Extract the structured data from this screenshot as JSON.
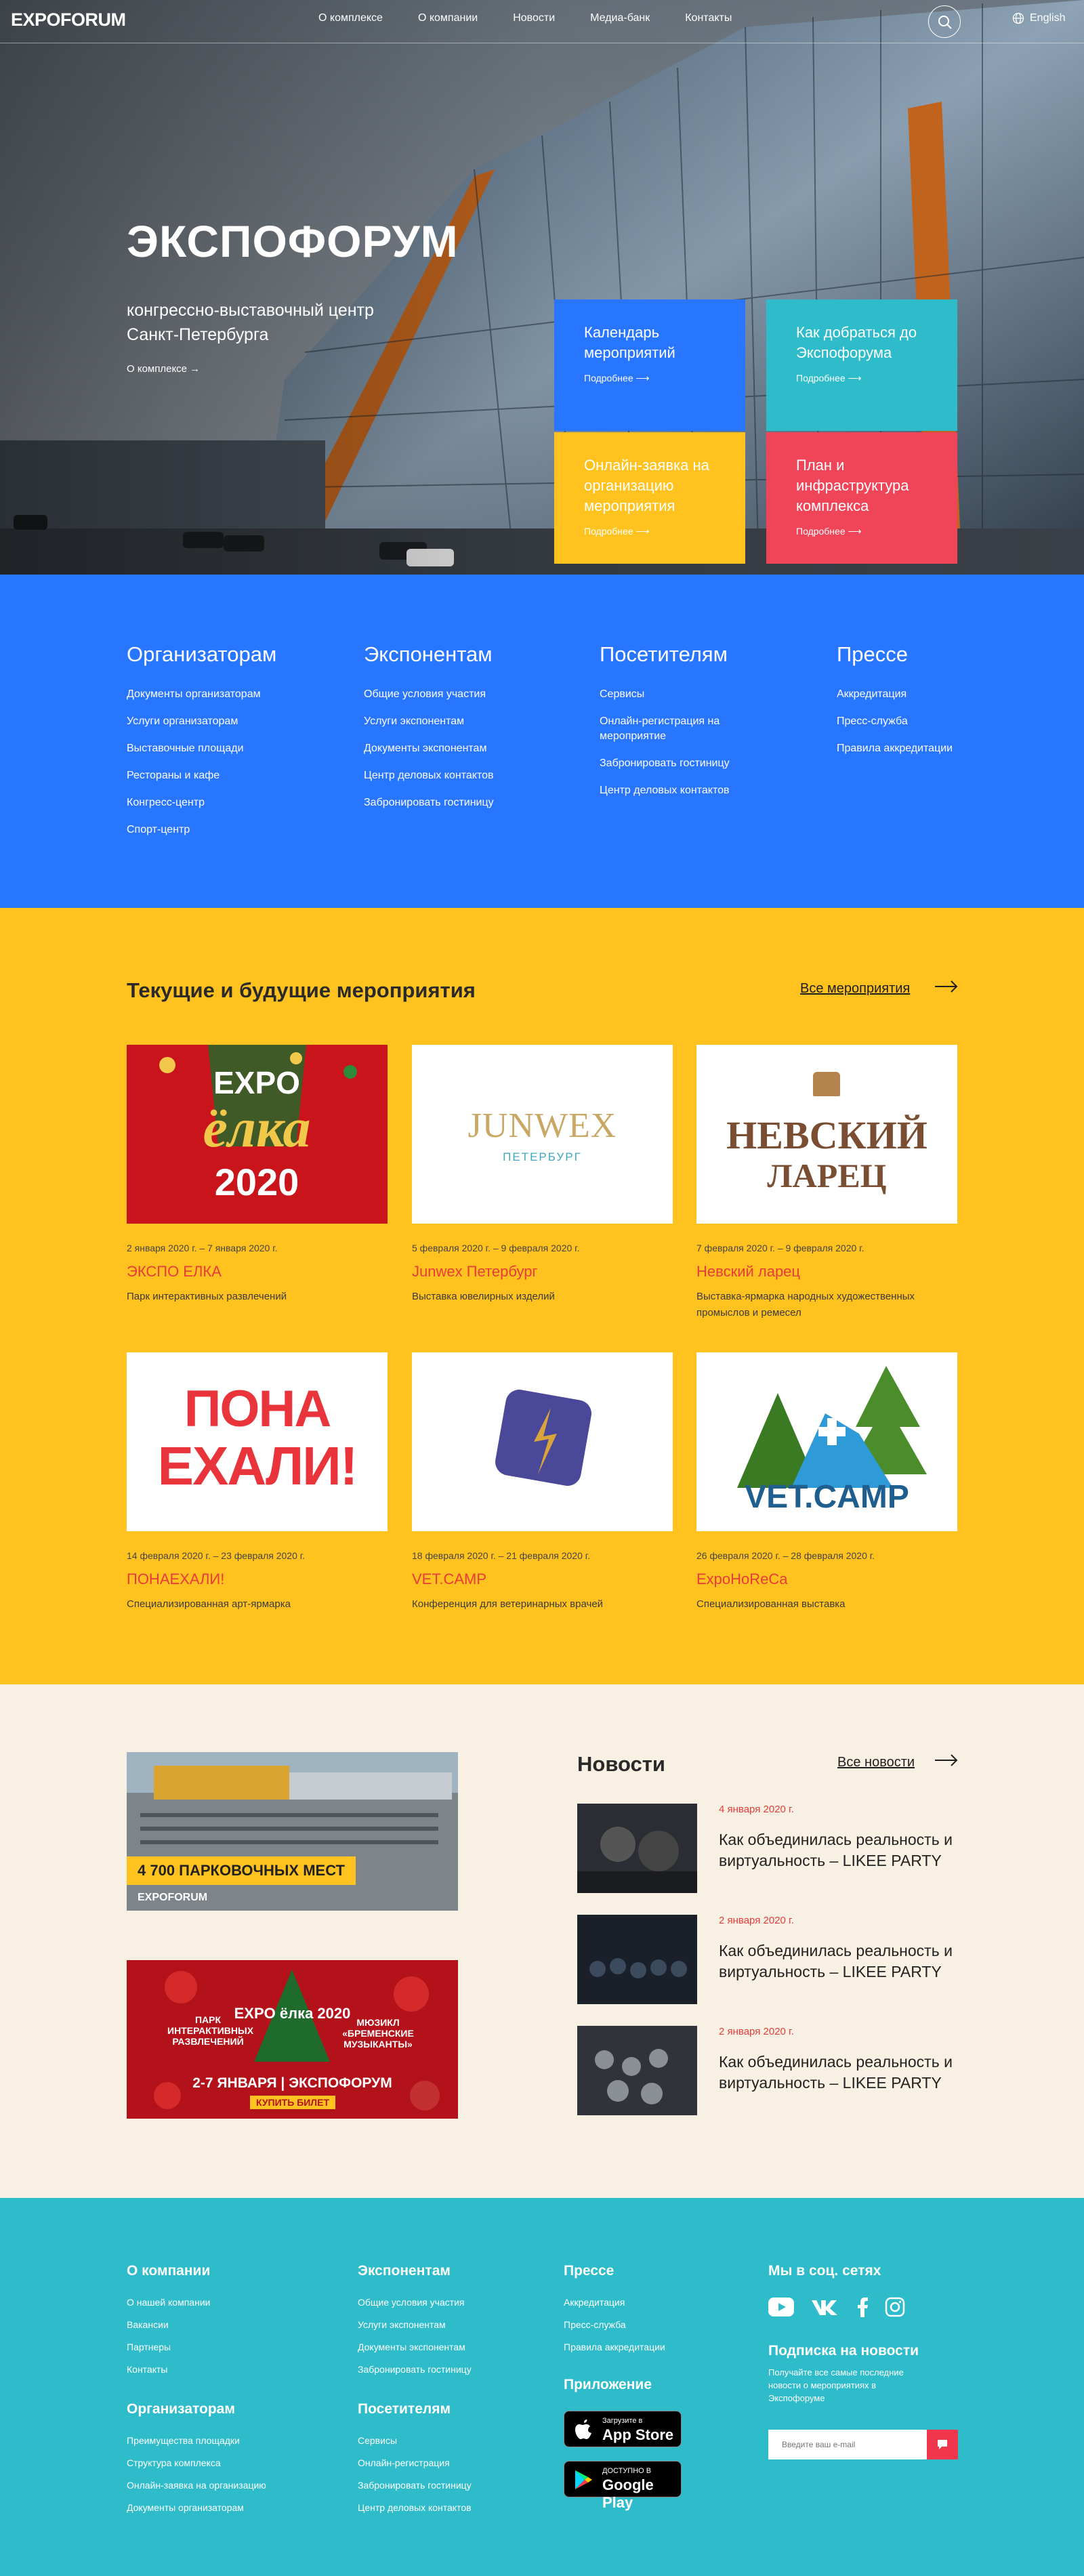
{
  "header": {
    "logo": "EXPOFORUM",
    "nav": [
      "О комплексе",
      "О компании",
      "Новости",
      "Медиа-банк",
      "Контакты"
    ],
    "lang": "English"
  },
  "hero": {
    "title": "ЭКСПОФОРУМ",
    "subtitle": "конгрессно-выставочный центр Санкт-Петербурга",
    "link": "О комплексе →",
    "tiles": [
      {
        "title": "Календарь мероприятий",
        "more": "Подробнее ⟶",
        "color": "#2876ff"
      },
      {
        "title": "Как добраться до Экспофорума",
        "more": "Подробнее ⟶",
        "color": "#2ebccb"
      },
      {
        "title": "Онлайн-заявка на организацию мероприятия",
        "more": "Подробнее ⟶",
        "color": "#ffc21e"
      },
      {
        "title": "План и инфраструктура комплекса",
        "more": "Подробнее ⟶",
        "color": "#f04458"
      }
    ]
  },
  "audience": [
    {
      "title": "Организаторам",
      "links": [
        "Документы организаторам",
        "Услуги организаторам",
        "Выставочные площади",
        "Рестораны и кафе",
        "Конгресс-центр",
        "Спорт-центр"
      ]
    },
    {
      "title": "Экспонентам",
      "links": [
        "Общие условия участия",
        "Услуги экспонентам",
        "Документы экспонентам",
        "Центр деловых контактов",
        "Забронировать гостиницу"
      ]
    },
    {
      "title": "Посетителям",
      "links": [
        "Сервисы",
        "Онлайн-регистрация на мероприятие",
        "Забронировать гостиницу",
        "Центр деловых контактов"
      ]
    },
    {
      "title": "Прессе",
      "links": [
        "Аккредитация",
        "Пресс-служба",
        "Правила аккредитации"
      ]
    }
  ],
  "events": {
    "title": "Текущие и будущие мероприятия",
    "all": "Все мероприятия",
    "items": [
      {
        "date": "2 января 2020 г. – 7 января 2020 г.",
        "name": "ЭКСПО ЕЛКА",
        "desc": "Парк интерактивных развлечений",
        "logo": "EXPO ёлка 2020"
      },
      {
        "date": "5 февраля 2020 г. – 9 февраля 2020 г.",
        "name": "Junwex Петербург",
        "desc": "Выставка ювелирных изделий",
        "logo": "JUNWEX",
        "logo2": "ПЕТЕРБУРГ"
      },
      {
        "date": "7 февраля 2020 г. – 9 февраля 2020 г.",
        "name": "Невский ларец",
        "desc": "Выставка-ярмарка народных художественных промыслов и ремесел",
        "logo": "НЕВСКИЙ",
        "logo2": "ЛАРЕЦ"
      },
      {
        "date": "14 февраля 2020 г. – 23 февраля 2020 г.",
        "name": "ПОНАЕХАЛИ!",
        "desc": "Специализированная арт-ярмарка",
        "logo": "ПОНА",
        "logo2": "ЕХАЛИ!"
      },
      {
        "date": "18 февраля 2020 г. – 21 февраля 2020 г.",
        "name": "VET.CAMP",
        "desc": "Конференция для ветеринарных врачей",
        "logo": ""
      },
      {
        "date": "26 февраля 2020 г. – 28 февраля 2020 г.",
        "name": "ExpoHoReCa",
        "desc": "Специализированная выставка",
        "logo": "VET.CAMP"
      }
    ]
  },
  "banners": {
    "parking": "4 700 ПАРКОВОЧНЫХ МЕСТ",
    "parking_logo": "EXPOFORUM",
    "elka_left": "ПАРК ИНТЕРАКТИВНЫХ РАЗВЛЕЧЕНИЙ",
    "elka_right": "МЮЗИКЛ «БРЕМЕНСКИЕ МУЗЫКАНТЫ»",
    "elka_logo": "EXPO ёлка 2020",
    "elka_dates": "2-7 ЯНВАРЯ | ЭКСПОФОРУМ",
    "elka_btn": "КУПИТЬ БИЛЕТ"
  },
  "news": {
    "title": "Новости",
    "all": "Все новости",
    "items": [
      {
        "date": "4 января 2020 г.",
        "title": "Как объединилась реальность и виртуальность – LIKEE PARTY"
      },
      {
        "date": "2 января 2020 г.",
        "title": "Как объединилась реальность и виртуальность – LIKEE PARTY"
      },
      {
        "date": "2 января 2020 г.",
        "title": "Как объединилась реальность и виртуальность – LIKEE PARTY"
      }
    ]
  },
  "footer": {
    "company": {
      "title": "О компании",
      "links": [
        "О нашей компании",
        "Вакансии",
        "Партнеры",
        "Контакты"
      ]
    },
    "exhibitors": {
      "title": "Экспонентам",
      "links": [
        "Общие условия участия",
        "Услуги экспонентам",
        "Документы экспонентам",
        "Забронировать гостиницу"
      ]
    },
    "press": {
      "title": "Прессе",
      "links": [
        "Аккредитация",
        "Пресс-служба",
        "Правила аккредитации"
      ]
    },
    "social": {
      "title": "Мы в соц. сетях"
    },
    "organizers": {
      "title": "Организаторам",
      "links": [
        "Преимущества площадки",
        "Структура комплекса",
        "Онлайн-заявка на организацию",
        "Документы организаторам"
      ]
    },
    "visitors": {
      "title": "Посетителям",
      "links": [
        "Сервисы",
        "Онлайн-регистрация",
        "Забронировать гостиницу",
        "Центр деловых контактов"
      ]
    },
    "app": {
      "title": "Приложение",
      "appstore_small": "Загрузите в",
      "appstore": "App Store",
      "gplay_small": "ДОСТУПНО В",
      "gplay": "Google Play"
    },
    "subscribe": {
      "title": "Подписка на новости",
      "text": "Получайте все самые последние новости о мероприятиях в Экспофоруме",
      "placeholder": "Введите ваш e-mail"
    }
  }
}
